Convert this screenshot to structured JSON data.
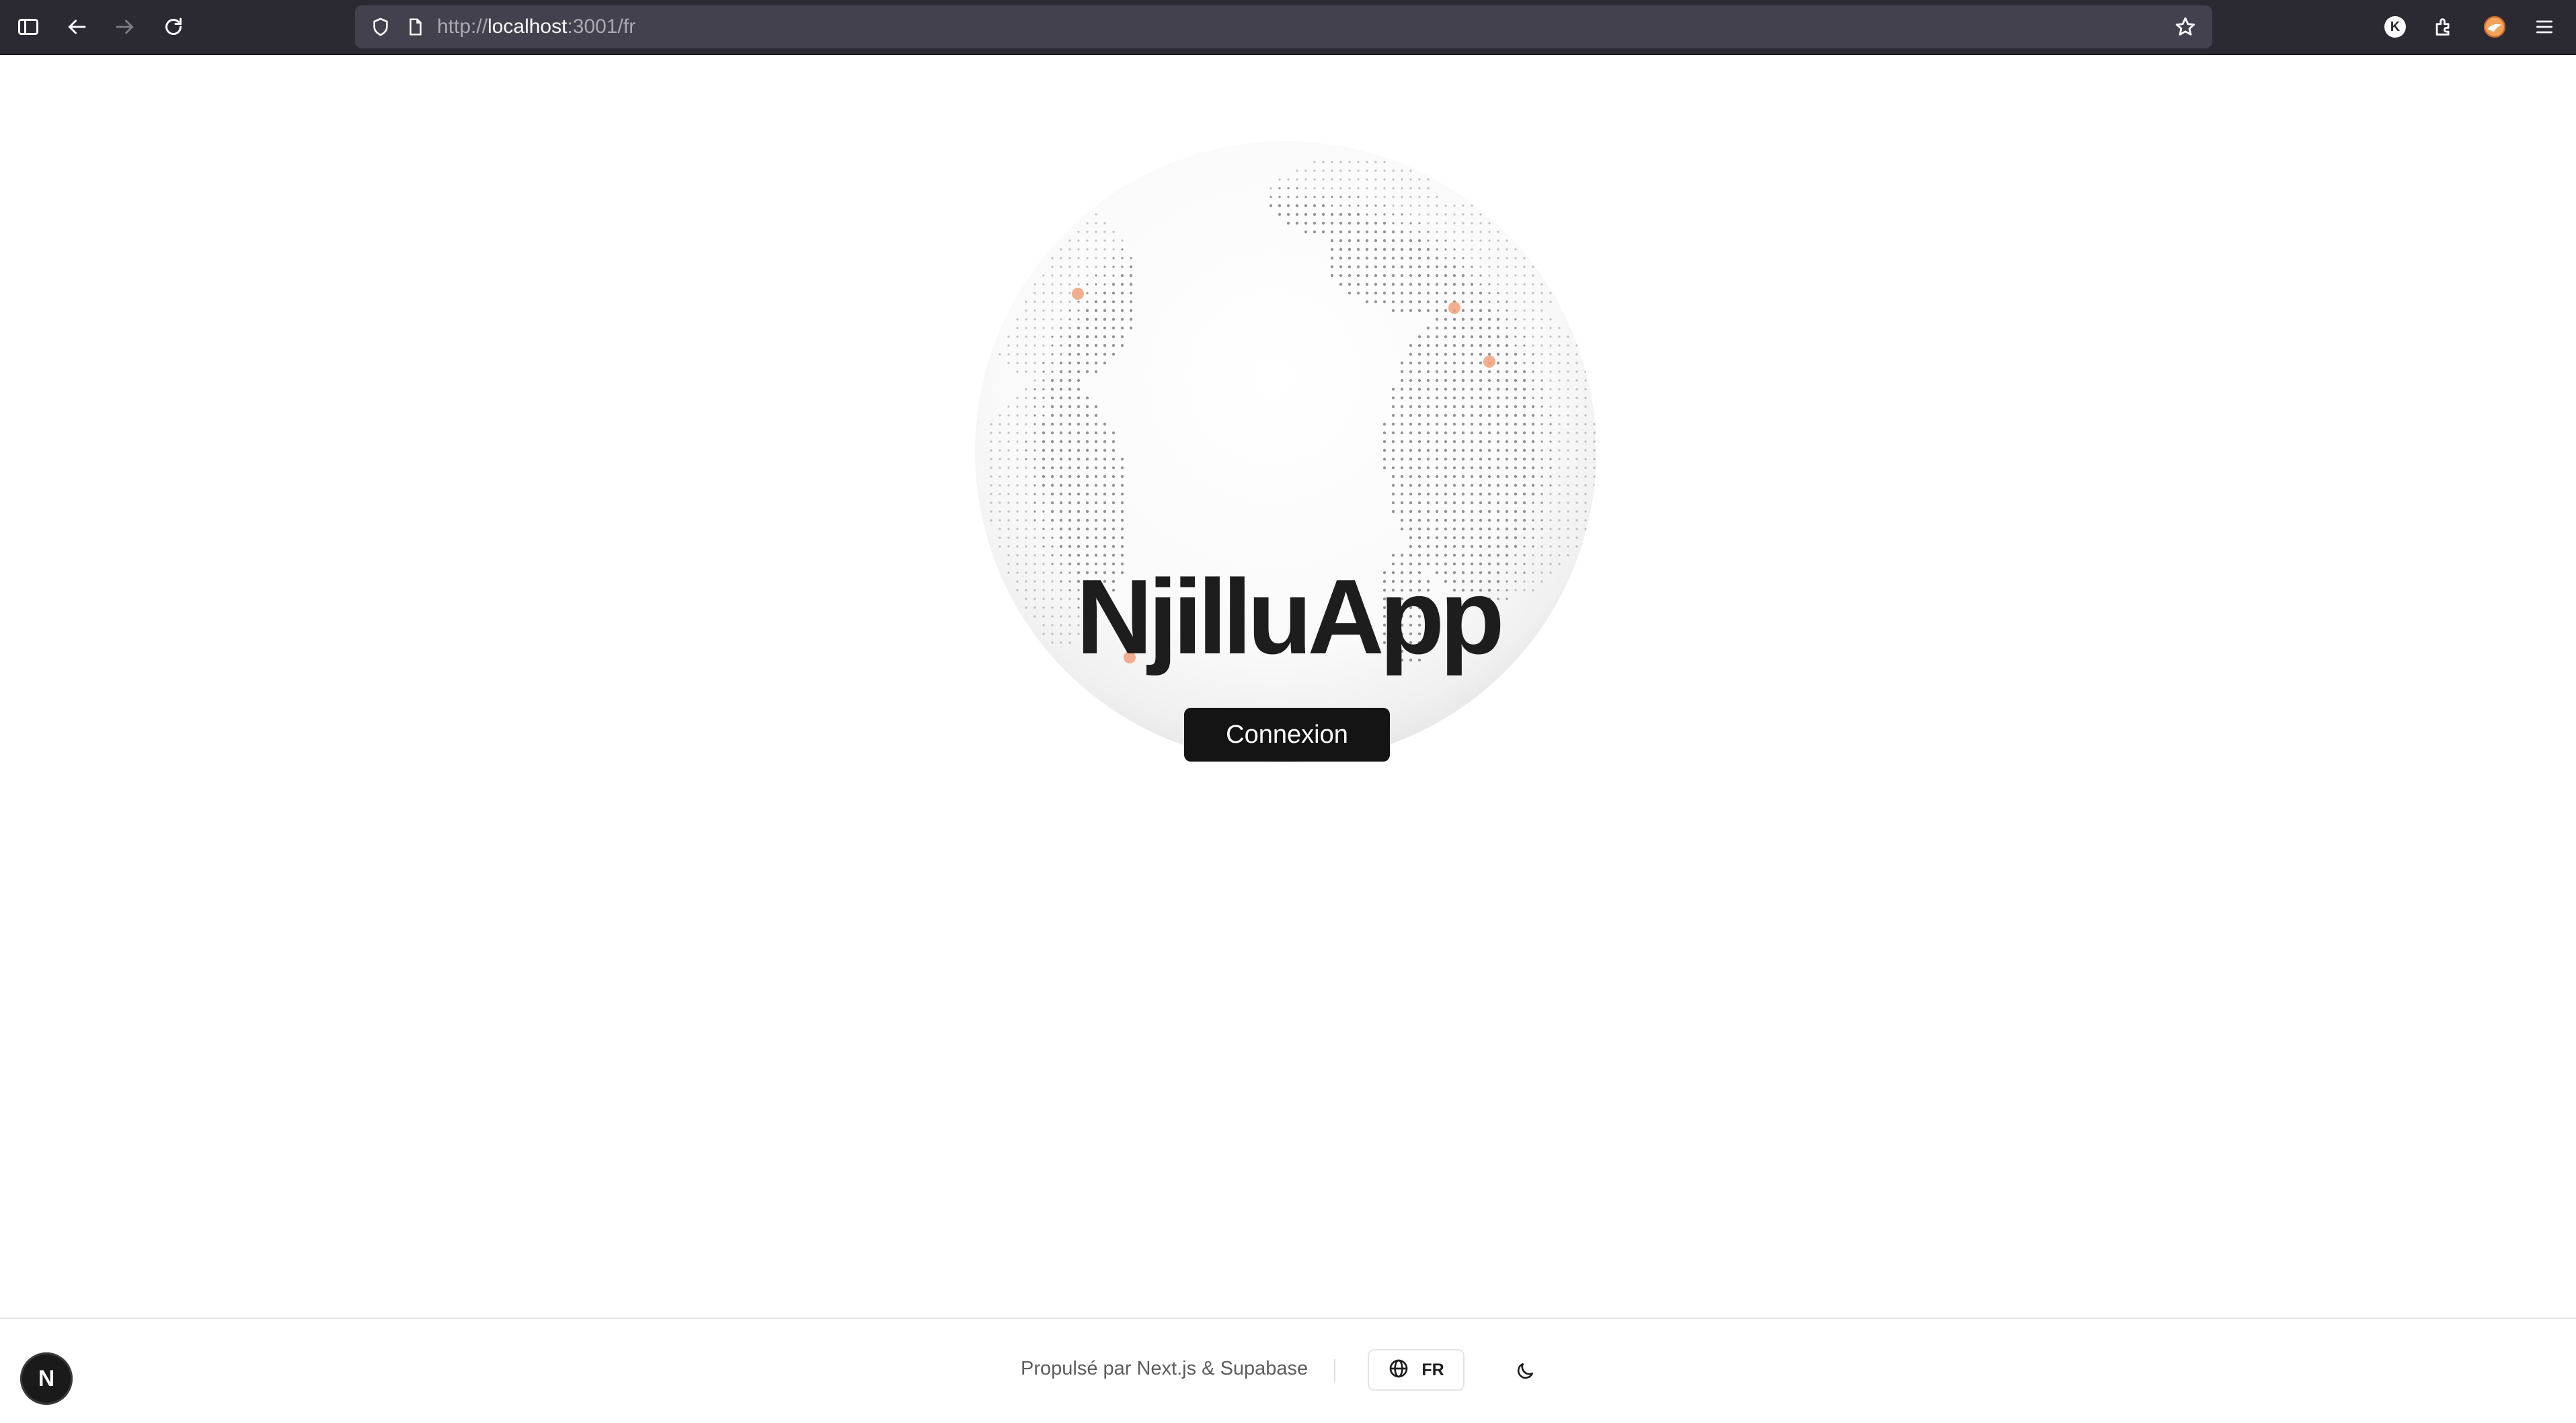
{
  "browser": {
    "url_scheme": "http://",
    "url_host": "localhost",
    "url_path": ":3001/fr",
    "profile_initial": "K",
    "icons": [
      "sidebar-icon",
      "back-icon",
      "forward-icon",
      "reload-icon",
      "shield-icon",
      "page-icon",
      "star-icon",
      "account-icon",
      "extensions-icon",
      "fox-icon",
      "menu-icon"
    ]
  },
  "hero": {
    "title": "NjilluApp",
    "login_label": "Connexion",
    "globe_markers_color": "#f0a07a"
  },
  "footer": {
    "powered_by": "Propulsé par Next.js & Supabase",
    "language_code": "FR",
    "avatar_initial": "N"
  },
  "colors": {
    "chrome_bg": "#2b2a33",
    "urlbar_bg": "#42414d",
    "button_bg": "#141414",
    "title_color": "#1d1d1d"
  }
}
